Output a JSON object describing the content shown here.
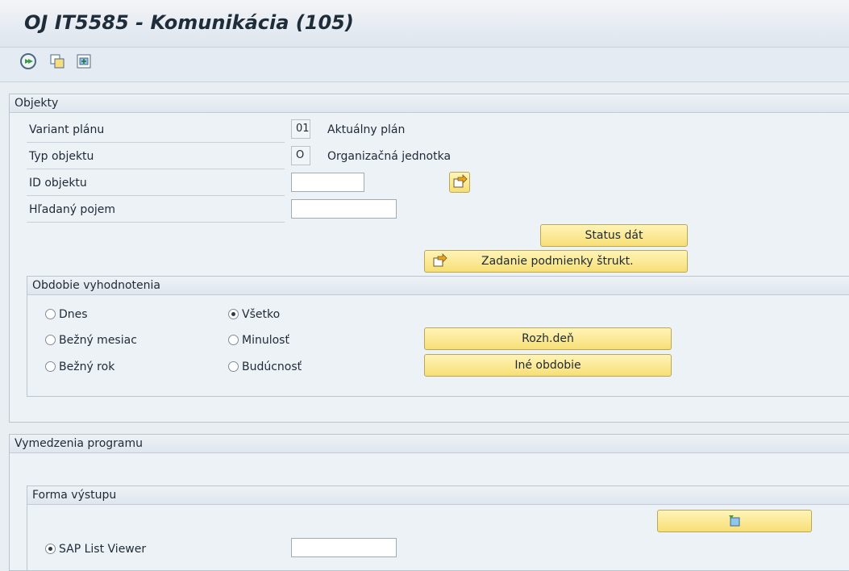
{
  "window": {
    "title": "OJ IT5585 - Komunikácia (105)"
  },
  "toolbar": {
    "icons": [
      "execute-icon",
      "copy-variant-icon",
      "selection-options-icon"
    ]
  },
  "objects": {
    "header": "Objekty",
    "plan_variant": {
      "label": "Variant plánu",
      "code": "01",
      "text": "Aktuálny plán"
    },
    "object_type": {
      "label": "Typ objektu",
      "code": "O",
      "text": "Organizačná jednotka"
    },
    "object_id": {
      "label": "ID objektu",
      "value": ""
    },
    "search_term": {
      "label": "Hľadaný pojem",
      "value": ""
    },
    "status_button": "Status dát",
    "structure_button": "Zadanie podmienky štrukt."
  },
  "period": {
    "header": "Obdobie vyhodnotenia",
    "options": [
      {
        "label": "Dnes",
        "selected": false
      },
      {
        "label": "Bežný mesiac",
        "selected": false
      },
      {
        "label": "Bežný rok",
        "selected": false
      },
      {
        "label": "Všetko",
        "selected": true
      },
      {
        "label": "Minulosť",
        "selected": false
      },
      {
        "label": "Budúcnosť",
        "selected": false
      }
    ],
    "key_date_button": "Rozh.deň",
    "other_period_button": "Iné obdobie"
  },
  "program": {
    "header": "Vymedzenia programu",
    "output": {
      "header": "Forma výstupu",
      "alv_label": "SAP List Viewer",
      "alv_selected": true,
      "layout_value": ""
    }
  }
}
